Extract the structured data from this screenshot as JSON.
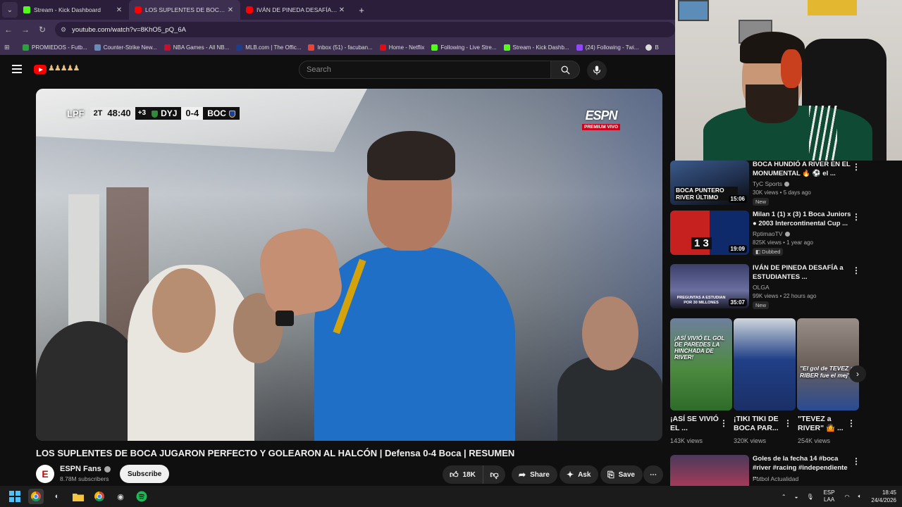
{
  "browser": {
    "tabs": [
      {
        "title": "Stream - Kick Dashboard",
        "icon": "kick-icon",
        "active": false
      },
      {
        "title": "LOS SUPLENTES DE BOCA JUGARON",
        "icon": "youtube-icon",
        "active": true
      },
      {
        "title": "IVÁN DE PINEDA DESAFÍA a ESTUDIANTES",
        "icon": "youtube-icon",
        "active": false
      }
    ],
    "url": "youtube.com/watch?v=8KhO5_pQ_6A",
    "bookmarks": [
      "PROMIEDOS - Futb...",
      "Counter-Strike New...",
      "NBA Games - All NB...",
      "MLB.com | The Offic...",
      "Inbox (51) - facuban...",
      "Home - Netflix",
      "Following - Live Stre...",
      "Stream - Kick Dashb...",
      "(24) Following - Twi...",
      "B"
    ]
  },
  "youtube": {
    "search_placeholder": "Search",
    "video": {
      "scorebug": {
        "league": "LPF",
        "half": "2T",
        "clock": "48:40",
        "added": "+3",
        "home": "DYJ",
        "score": "0-4",
        "away": "BOC"
      },
      "broadcaster": "ESPN",
      "broadcaster_tag": "PREMIUM VIVO"
    },
    "title": "LOS SUPLENTES DE BOCA JUGARON PERFECTO Y GOLEARON AL HALCÓN | Defensa 0-4 Boca | RESUMEN",
    "channel": {
      "name": "ESPN Fans",
      "subscribers": "8.78M subscribers",
      "subscribe_label": "Subscribe"
    },
    "actions": {
      "likes": "18K",
      "share": "Share",
      "ask": "Ask",
      "save": "Save"
    },
    "recommendations": [
      {
        "title": "BOCA HUNDIÓ A RIVER EN EL MONUMENTAL 🔥 ⚽ el ...",
        "channel": "TyC Sports",
        "meta": "30K views • 5 days ago",
        "badge": "New",
        "duration": "15:06",
        "thumb_text": "BOCA PUNTERO RIVER ÚLTIMO"
      },
      {
        "title": "Milan 1 (1) x (3) 1 Boca Juniors ● 2003 Intercontinental Cup ...",
        "channel": "RptimaoTV",
        "meta": "825K views • 1 year ago",
        "badge": "Dubbed",
        "duration": "19:09",
        "thumb_text": "1 3"
      },
      {
        "title": "IVÁN DE PINEDA DESAFÍA a ESTUDIANTES ...",
        "channel": "OLGA",
        "meta": "99K views • 22 hours ago",
        "badge": "New",
        "duration": "35:07",
        "thumb_text": "PREGUNTAS A ESTUDIAN POR 30 MILLONES"
      }
    ],
    "shorts": [
      {
        "title": "¡ASÍ SE VIVIÓ EL ...",
        "views": "143K views",
        "caption": "¡ASÍ VIVIÓ EL GOL DE PAREDES LA HINCHADA DE RIVER!"
      },
      {
        "title": "¡TIKI TIKI DE BOCA PAR...",
        "views": "320K views",
        "caption": ""
      },
      {
        "title": "\"TEVEZ a RIVER\" 🤷 ...",
        "views": "254K views",
        "caption": "\"El gol de TEVEZ a RIBER fue el mej\""
      }
    ],
    "last_recommendation": {
      "title": "Goles de la fecha 14 #boca #river #racing #independiente ...",
      "channel": "Futbol Actualidad"
    }
  },
  "taskbar": {
    "language": "ESP",
    "region": "LAA",
    "time": "18:45",
    "date": "24/4/2026"
  }
}
